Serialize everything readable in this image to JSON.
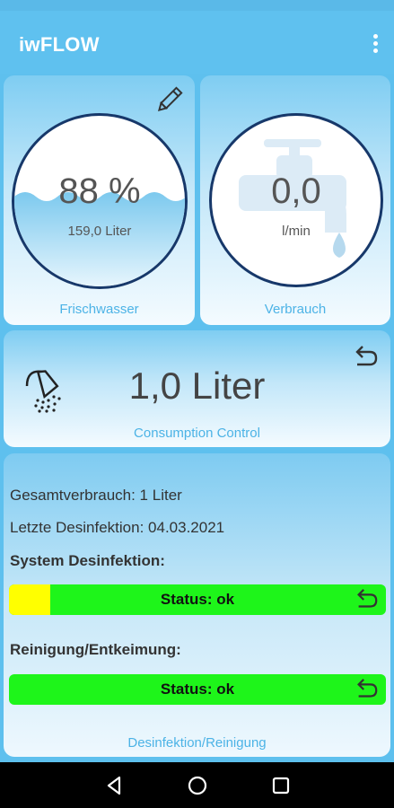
{
  "app": {
    "title": "iwFLOW"
  },
  "fresh_water": {
    "percent_label": "88 %",
    "volume_label": "159,0 Liter",
    "caption": "Frischwasser",
    "fill_percent": 88
  },
  "consumption_gauge": {
    "value_label": "0,0",
    "unit_label": "l/min",
    "caption": "Verbrauch"
  },
  "consumption_control": {
    "value_label": "1,0 Liter",
    "caption": "Consumption Control"
  },
  "disinfection": {
    "total_consumption": "Gesamtverbrauch: 1 Liter",
    "last_disinfection": "Letzte Desinfektion: 04.03.2021",
    "system_heading": "System Desinfektion:",
    "system_status": "Status: ok",
    "system_progress_fraction": 0.11,
    "cleaning_heading": "Reinigung/Entkeimung:",
    "cleaning_status": "Status: ok",
    "caption": "Desinfektion/Reinigung"
  },
  "icons": [
    "edit-pencil-icon",
    "faucet-icon",
    "shower-icon",
    "reset-arrow-icon",
    "overflow-menu-icon",
    "nav-back-icon",
    "nav-home-icon",
    "nav-recents-icon"
  ],
  "colors": {
    "accent": "#5fc1ef",
    "status_ok": "#1ef51a",
    "status_warn": "#ffff00",
    "gauge_ring": "#17386a"
  }
}
